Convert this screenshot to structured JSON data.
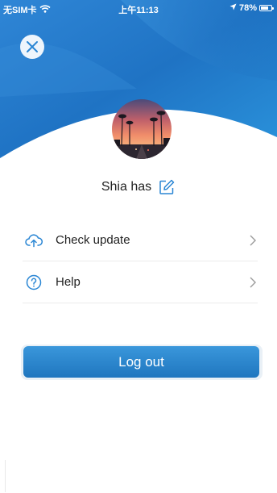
{
  "status_bar": {
    "carrier": "无SIM卡",
    "time": "上午11:13",
    "battery": "78%",
    "battery_level": 0.78
  },
  "profile": {
    "username": "Shia has"
  },
  "menu": {
    "items": [
      {
        "label": "Check update",
        "icon": "cloud-upload-icon"
      },
      {
        "label": "Help",
        "icon": "help-circle-icon"
      }
    ]
  },
  "logout": {
    "label": "Log out"
  },
  "colors": {
    "header_blue": "#1e7fcf",
    "accent": "#2f8fd8",
    "button_top": "#3a97db",
    "button_bottom": "#1f76bf"
  }
}
